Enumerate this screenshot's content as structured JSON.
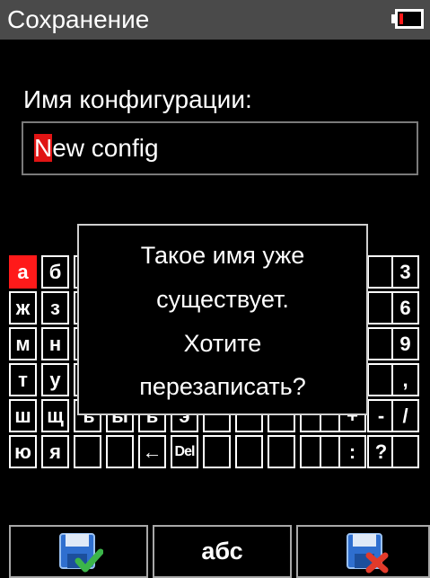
{
  "title": "Сохранение",
  "battery_icon": "battery-low-icon",
  "label": "Имя конфигурации:",
  "input": {
    "cursor_char": "N",
    "rest_text": "ew config"
  },
  "keyboard": {
    "rows": [
      [
        "а",
        "б",
        "",
        "",
        "",
        "",
        "",
        "",
        "",
        "",
        "",
        "",
        "",
        "3"
      ],
      [
        "ж",
        "з",
        "",
        "",
        "",
        "",
        "",
        "",
        "",
        "",
        "",
        "",
        "",
        "6"
      ],
      [
        "м",
        "н",
        "",
        "",
        "",
        "",
        "",
        "",
        "",
        "",
        "",
        "",
        "",
        "9"
      ],
      [
        "т",
        "у",
        "",
        "",
        "",
        "",
        "",
        "",
        "",
        "",
        "",
        "",
        "",
        ","
      ],
      [
        "ш",
        "щ",
        "ъ",
        "ы",
        "ь",
        "э",
        "",
        "",
        "",
        "",
        "",
        "+",
        "-",
        "/"
      ],
      [
        "ю",
        "я",
        "",
        "",
        "←",
        "Del",
        "",
        "",
        "",
        "",
        "",
        ":",
        "?",
        ""
      ]
    ],
    "selected": "а"
  },
  "dialog": {
    "lines": [
      "Такое имя уже",
      "существует.",
      "Хотите",
      "перезаписать?"
    ]
  },
  "softkeys": {
    "left_icon": "save-confirm-icon",
    "center_label": "абс",
    "right_icon": "save-cancel-icon"
  },
  "colors": {
    "accent_red": "#ff1a1a",
    "title_bg": "#4a4a4a",
    "check_green": "#3cb54a",
    "floppy_blue": "#2f6fcf"
  }
}
